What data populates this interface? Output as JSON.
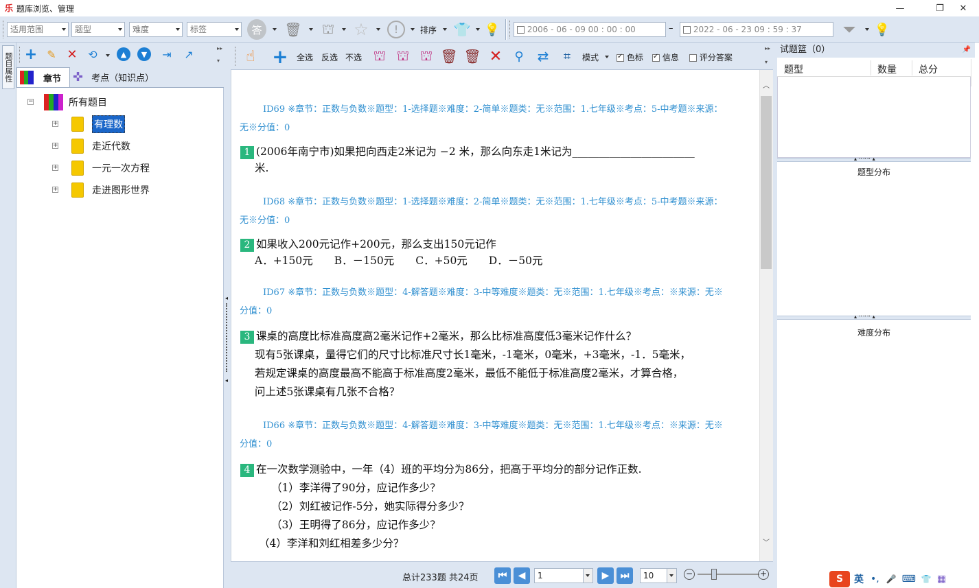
{
  "window": {
    "title": "题库浏览、管理",
    "minimize": "—",
    "maximize": "❐",
    "close": "✕"
  },
  "filters": {
    "scope": "适用范围",
    "type": "题型",
    "difficulty": "难度",
    "tag": "标签",
    "sort_label": "排序",
    "date_from": "2006 - 06 - 09    00 : 00 : 00",
    "date_sep": "–",
    "date_to": "2022 - 06 - 23    09 : 59 : 37"
  },
  "left_strip": {
    "vtab": "题目属性"
  },
  "left_tabs": {
    "chapter": "章节",
    "knowledge": "考点（知识点）"
  },
  "tree": {
    "root": "所有题目",
    "items": [
      "有理数",
      "走近代数",
      "一元一次方程",
      "走进图形世界"
    ],
    "selected": "有理数"
  },
  "mid_toolbar": {
    "select_all": "全选",
    "invert": "反选",
    "deselect": "不选",
    "mode": "模式",
    "color_label": "色标",
    "info_label": "信息",
    "score_answer": "评分答案",
    "color_checked": true,
    "info_checked": true,
    "score_checked": false
  },
  "questions": [
    {
      "meta1": "ID69 ※章节：正数与负数※题型：1-选择题※难度：2-简单※题类：无※范围：1.七年级※考点：5-中考题※来源：",
      "meta2": "无※分值：0",
      "num": "1",
      "lines": [
        "(2006年南宁市)如果把向西走2米记为 −2 米，那么向东走1米记为_______________________",
        "米."
      ]
    },
    {
      "meta1": "ID68 ※章节：正数与负数※题型：1-选择题※难度：2-简单※题类：无※范围：1.七年级※考点：5-中考题※来源：",
      "meta2": "无※分值：0",
      "num": "2",
      "lines": [
        "如果收入200元记作+200元，那么支出150元记作",
        "A．+150元　　B．－150元　　C．+50元　　D．－50元"
      ]
    },
    {
      "meta1": "ID67 ※章节：正数与负数※题型：4-解答题※难度：3-中等难度※题类：无※范围：1.七年级※考点：※来源：无※",
      "meta2": "分值：0",
      "num": "3",
      "lines": [
        "课桌的高度比标准高度高2毫米记作+2毫米，那么比标准高度低3毫米记作什么？",
        "现有5张课桌，量得它们的尺寸比标准尺寸长1毫米，-1毫米，0毫米，+3毫米，-1．5毫米，",
        "若规定课桌的高度最高不能高于标准高度2毫米，最低不能低于标准高度2毫米，才算合格，",
        "问上述5张课桌有几张不合格？"
      ]
    },
    {
      "meta1": "ID66 ※章节：正数与负数※题型：4-解答题※难度：3-中等难度※题类：无※范围：1.七年级※考点：※来源：无※",
      "meta2": "分值：0",
      "num": "4",
      "lines": [
        "在一次数学测验中，一年（4）班的平均分为86分，把高于平均分的部分记作正数.",
        "（1）李洋得了90分，应记作多少？",
        "（2）刘红被记作-5分，她实际得分多少？",
        "（3）王明得了86分，应记作多少？",
        "（4）李洋和刘红相差多少分？"
      ]
    }
  ],
  "pager": {
    "summary": "总计233题  共24页",
    "page": "1",
    "page_size": "10"
  },
  "basket": {
    "title": "试题篮（0）",
    "col_type": "题型",
    "col_count": "数量",
    "col_score": "总分",
    "type_dist": "题型分布",
    "diff_dist": "难度分布",
    "pin": "ᵖ"
  },
  "ime": {
    "logo": "S",
    "lang": "英",
    "punct": "•,",
    "mic": "🎤",
    "kbd": "⌨",
    "shirt": "👕",
    "grid": "▦"
  }
}
